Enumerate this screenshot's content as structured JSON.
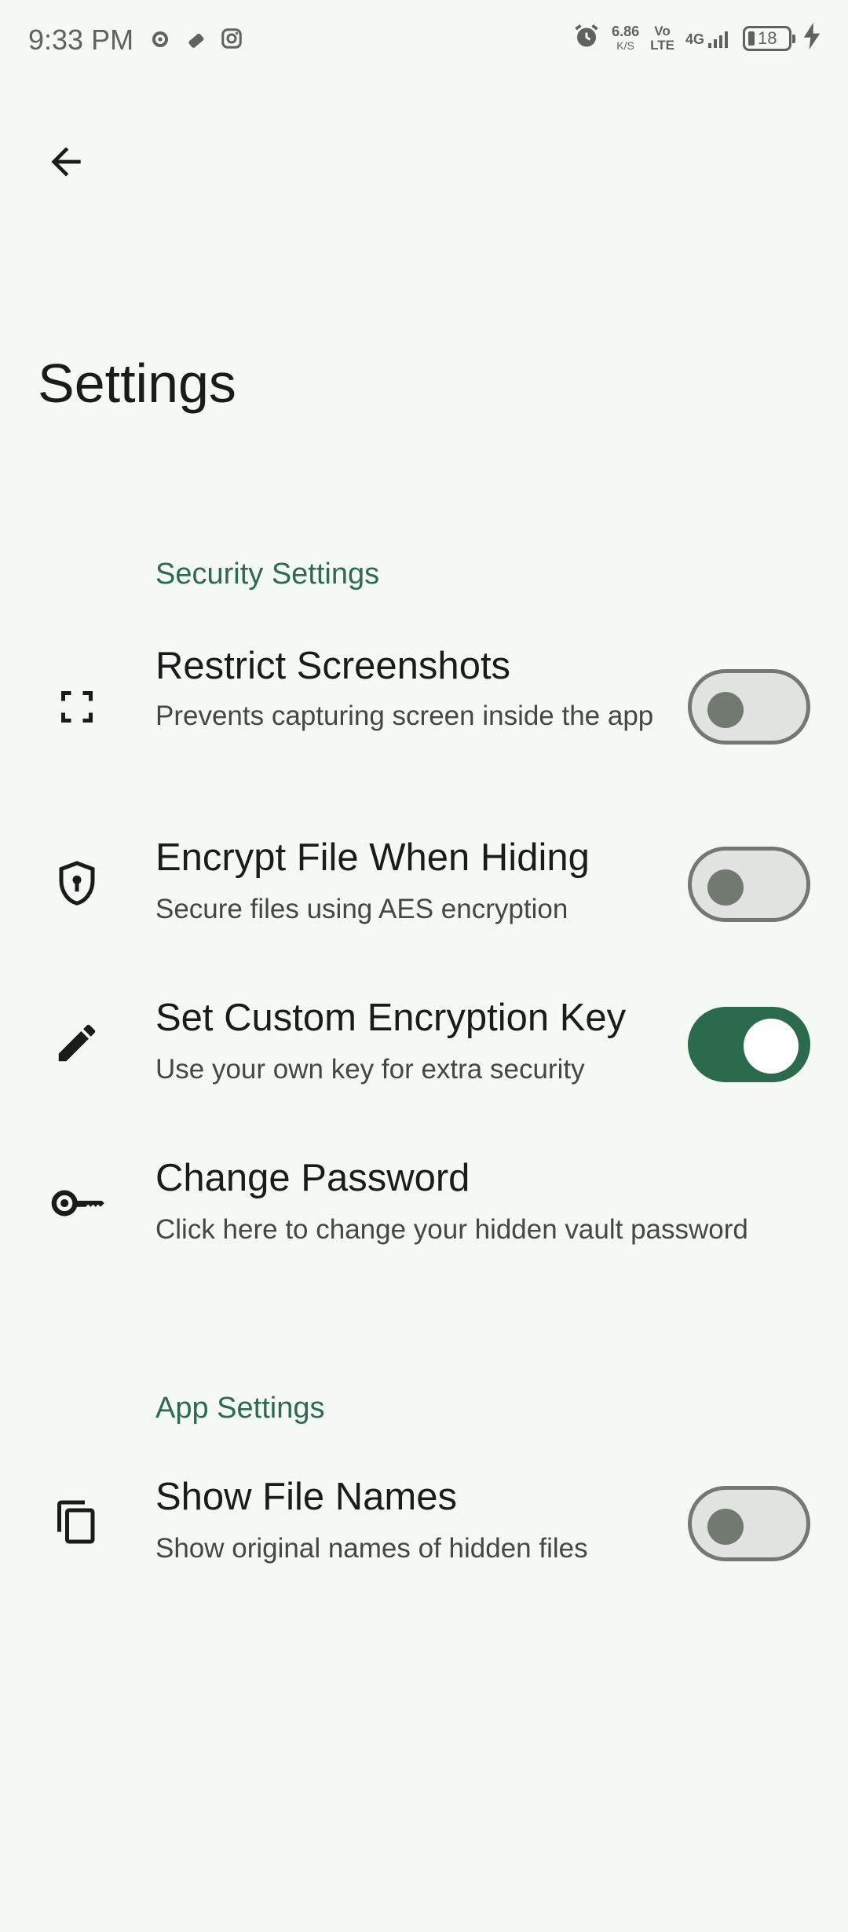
{
  "status_bar": {
    "time": "9:33 PM",
    "left_icons": [
      "settings-gear-icon",
      "usb-stick-icon",
      "instagram-icon"
    ],
    "alarm_icon": "alarm-icon",
    "speed_value": "6.86",
    "speed_unit": "K/S",
    "volte_top": "Vo",
    "volte_bottom": "LTE",
    "network": "4G",
    "battery_level": "18",
    "charging_icon": "charging-bolt-icon"
  },
  "header": {
    "back_icon": "arrow-back-icon",
    "title": "Settings"
  },
  "sections": [
    {
      "header": "Security Settings",
      "items": [
        {
          "icon": "fullscreen-icon",
          "title": "Restrict Screenshots",
          "summary": "Prevents capturing screen inside the app",
          "toggle": false
        },
        {
          "icon": "shield-lock-icon",
          "title": "Encrypt File When Hiding",
          "summary": "Secure files using AES encryption",
          "toggle": false
        },
        {
          "icon": "pencil-icon",
          "title": "Set Custom Encryption Key",
          "summary": "Use your own key for extra security",
          "toggle": true
        },
        {
          "icon": "key-icon",
          "title": "Change Password",
          "summary": "Click here to change your hidden vault password"
        }
      ]
    },
    {
      "header": "App Settings",
      "items": [
        {
          "icon": "copy-files-icon",
          "title": "Show File Names",
          "summary": "Show original names of hidden files",
          "toggle": false
        }
      ]
    }
  ],
  "colors": {
    "background": "#f4f9f3",
    "accent": "#2d6a4f",
    "switch_on": "#2b6a4c",
    "switch_off_track": "#e0e4df",
    "switch_off_outline": "#727971"
  }
}
